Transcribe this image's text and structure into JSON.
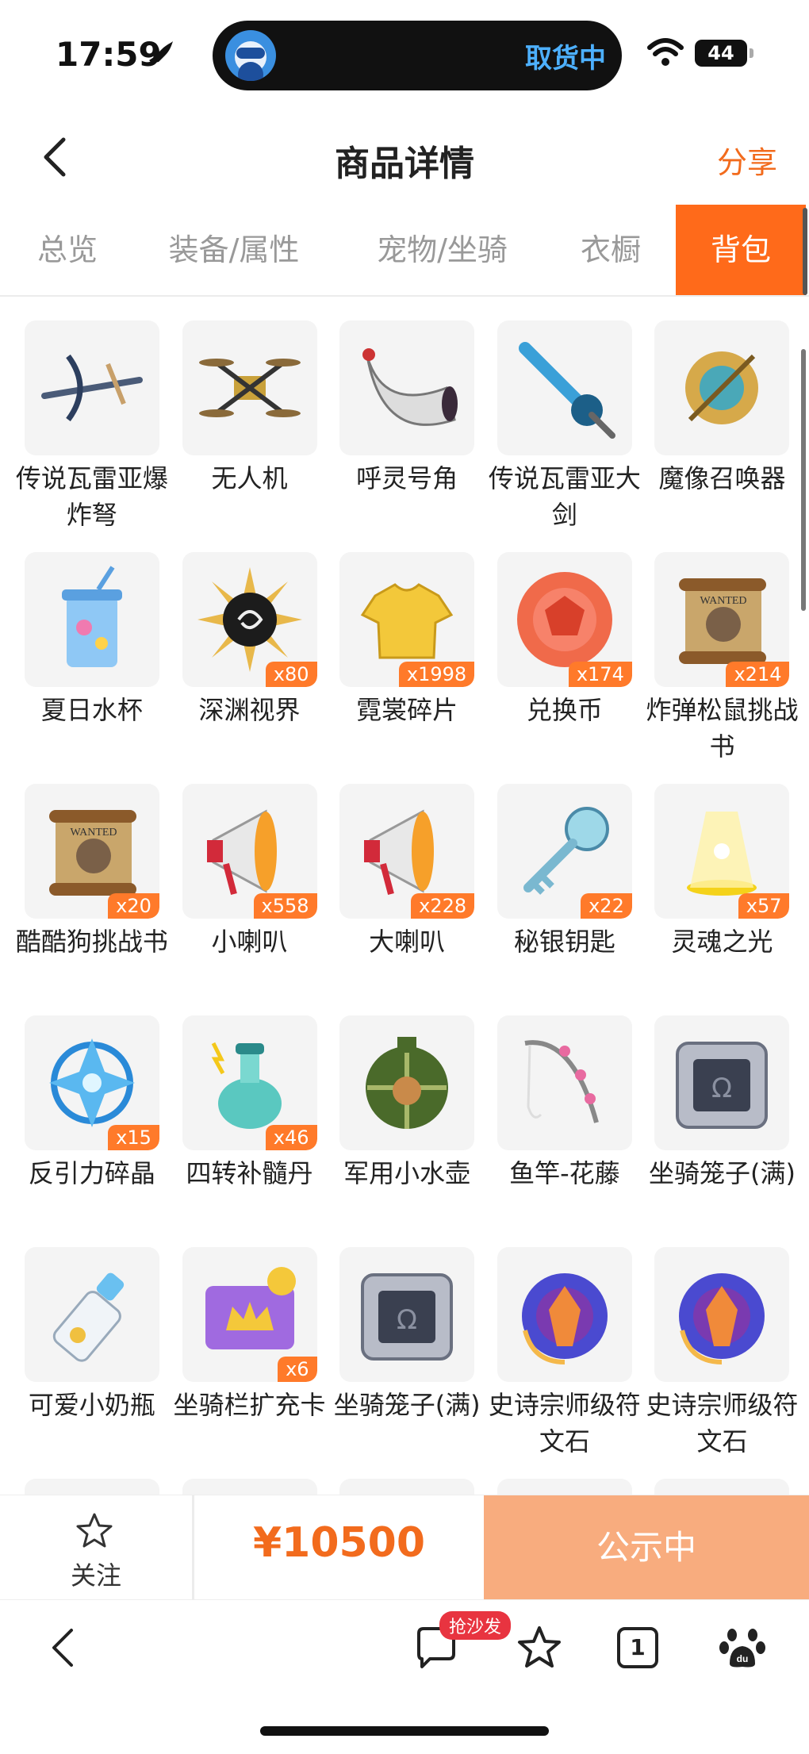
{
  "status": {
    "time": "17:59",
    "island_text": "取货中",
    "battery": "44"
  },
  "header": {
    "title": "商品详情",
    "share": "分享"
  },
  "tabs": [
    {
      "label": "总览",
      "active": false
    },
    {
      "label": "装备/属性",
      "active": false
    },
    {
      "label": "宠物/坐骑",
      "active": false
    },
    {
      "label": "衣橱",
      "active": false
    },
    {
      "label": "背包",
      "active": true
    }
  ],
  "items": [
    {
      "name": "传说瓦雷亚爆炸弩",
      "count": "",
      "icon": "crossbow-icon"
    },
    {
      "name": "无人机",
      "count": "",
      "icon": "drone-icon"
    },
    {
      "name": "呼灵号角",
      "count": "",
      "icon": "horn-icon"
    },
    {
      "name": "传说瓦雷亚大剑",
      "count": "",
      "icon": "sword-icon"
    },
    {
      "name": "魔像召唤器",
      "count": "",
      "icon": "golem-summoner-icon"
    },
    {
      "name": "夏日水杯",
      "count": "",
      "icon": "cup-icon"
    },
    {
      "name": "深渊视界",
      "count": "x80",
      "icon": "abyss-sun-icon"
    },
    {
      "name": "霓裳碎片",
      "count": "x1998",
      "icon": "shirt-icon"
    },
    {
      "name": "兑换币",
      "count": "x174",
      "icon": "coin-icon"
    },
    {
      "name": "炸弹松鼠挑战书",
      "count": "x214",
      "icon": "scroll-icon"
    },
    {
      "name": "酷酷狗挑战书",
      "count": "x20",
      "icon": "scroll-icon"
    },
    {
      "name": "小喇叭",
      "count": "x558",
      "icon": "megaphone-icon"
    },
    {
      "name": "大喇叭",
      "count": "x228",
      "icon": "megaphone-icon"
    },
    {
      "name": "秘银钥匙",
      "count": "x22",
      "icon": "key-icon"
    },
    {
      "name": "灵魂之光",
      "count": "x57",
      "icon": "light-icon"
    },
    {
      "name": "反引力碎晶",
      "count": "x15",
      "icon": "crystal-icon"
    },
    {
      "name": "四转补髓丹",
      "count": "x46",
      "icon": "potion-icon"
    },
    {
      "name": "军用小水壶",
      "count": "",
      "icon": "canteen-icon"
    },
    {
      "name": "鱼竿-花藤",
      "count": "",
      "icon": "fishing-rod-icon"
    },
    {
      "name": "坐骑笼子(满)",
      "count": "",
      "icon": "cage-icon"
    },
    {
      "name": "可爱小奶瓶",
      "count": "",
      "icon": "baby-bottle-icon"
    },
    {
      "name": "坐骑栏扩充卡",
      "count": "x6",
      "icon": "card-icon"
    },
    {
      "name": "坐骑笼子(满)",
      "count": "",
      "icon": "cage-icon"
    },
    {
      "name": "史诗宗师级符文石",
      "count": "",
      "icon": "rune-stone-icon"
    },
    {
      "name": "史诗宗师级符文石",
      "count": "",
      "icon": "rune-stone-icon"
    }
  ],
  "action_bar": {
    "follow": "关注",
    "price": "¥10500",
    "status_button": "公示中"
  },
  "browser_bar": {
    "sofa_badge": "抢沙发",
    "tab_count": "1"
  },
  "colors": {
    "accent": "#ff6a1a",
    "price": "#f26b1d",
    "button": "#f8ac7e"
  }
}
